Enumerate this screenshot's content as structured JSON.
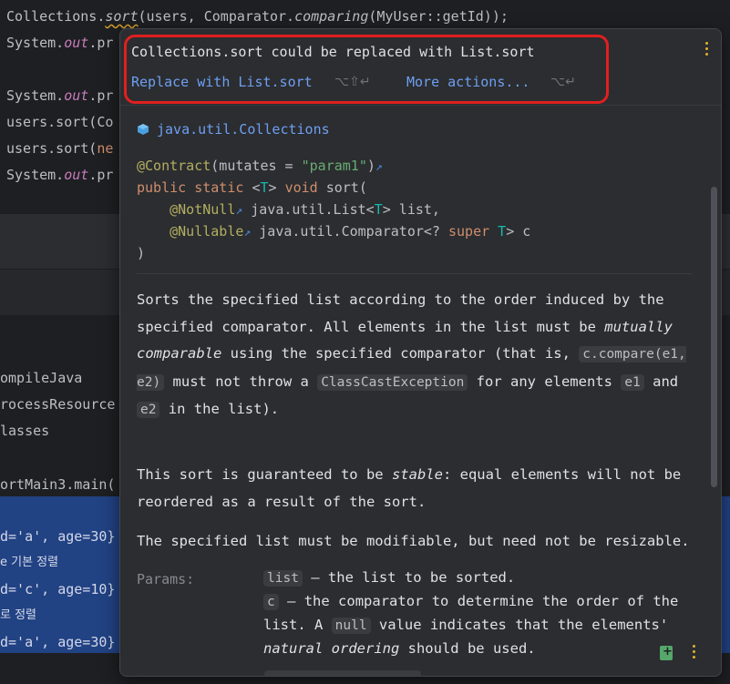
{
  "editor": {
    "lines": [
      {
        "pre": "Collections.",
        "em": "sort",
        "post": "(users, Comparator.",
        "em2": "comparing",
        "post2": "(MyUser::getId));"
      },
      {
        "pre": "System.",
        "field": "out",
        "post": ".pr"
      },
      {
        "pre": "System.",
        "field": "out",
        "post": ".pr"
      },
      {
        "pre": "users.sort(Co"
      },
      {
        "pre": "users.sort(",
        "new": "ne"
      },
      {
        "pre": "System.",
        "field": "out",
        "post": ".pr"
      }
    ]
  },
  "run": {
    "lines": [
      "ompileJava",
      "rocessResource",
      "lasses",
      "ortMain3.main("
    ],
    "selected": [
      "d='a', age=30}",
      "e 기본 정렬",
      "d='c', age=10}",
      "로 정렬",
      "d='a', age=30}"
    ]
  },
  "intention": {
    "title": "Collections.sort could be replaced with List.sort",
    "replace_label": "Replace with List.sort",
    "replace_shortcut": "⌥⇧↵",
    "more_label": "More actions...",
    "more_shortcut": "⌥↵"
  },
  "doc": {
    "package": "java.util.Collections",
    "sig": {
      "contract": "@Contract",
      "contract_args_pre": "(mutates = ",
      "contract_str": "\"param1\"",
      "contract_close": ")",
      "public_static": "public static",
      "type_param_open": "<",
      "type_param": "T",
      "type_param_close": ">",
      "void": "void",
      "method": "sort(",
      "notnull": "@NotNull",
      "list_type": "java.util.List<",
      "list_type_close": "> list,",
      "nullable": "@Nullable",
      "comp_type": "java.util.Comparator<?",
      "super": "super",
      "comp_close": "> c",
      "close": ")"
    },
    "p1": {
      "t1": "Sorts the specified list according to the order induced by the specified comparator. All elements in the list must be ",
      "em": "mutually comparable",
      "t2": " using the specified comparator (that is, ",
      "code1": "c.compare(e1, e2)",
      "t3": " must not throw a ",
      "code2": "ClassCastException",
      "t4": " for any elements ",
      "code3": "e1",
      "t5": " and ",
      "code4": "e2",
      "t6": " in the list)."
    },
    "p2": {
      "t1": "This sort is guaranteed to be ",
      "em": "stable",
      "t2": ": equal elements will not be reordered as a result of the sort."
    },
    "p3": "The specified list must be modifiable, but need not be resizable.",
    "params_label": "Params:",
    "params": {
      "list_code": "list",
      "list_desc": " – the list to be sorted.",
      "c_code": "c",
      "c_desc1": " – the comparator to determine the order of the list. A ",
      "null_code": "null",
      "c_desc2": " value indicates that the elements' ",
      "em": "natural ordering",
      "c_desc3": " should be used."
    }
  },
  "colors": {
    "highlight": "#e0201f",
    "link": "#6f9ff2",
    "selection": "#214283"
  }
}
